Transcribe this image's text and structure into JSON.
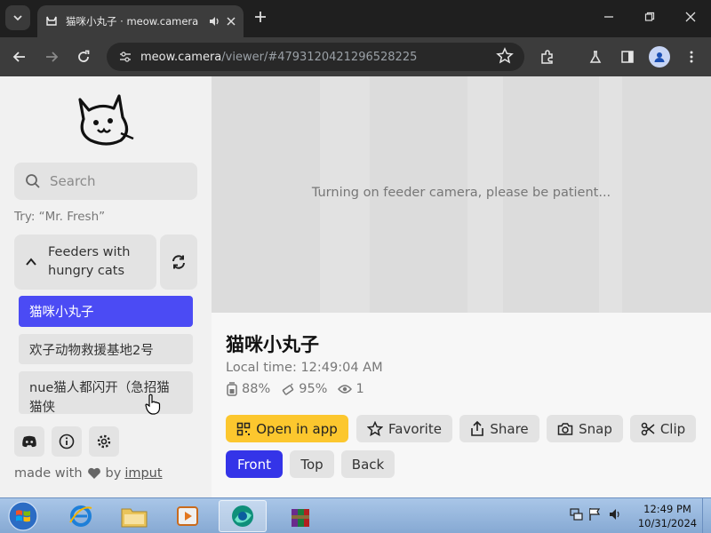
{
  "browser": {
    "tab_title": "猫咪小丸子 · meow.camera",
    "url_host": "meow.camera",
    "url_path": "/viewer/#4793120421296528225"
  },
  "sidebar": {
    "search_placeholder": "Search",
    "search_hint": "Try: “Mr. Fresh”",
    "feeders_label": "Feeders with hungry cats",
    "feeders": [
      {
        "label": "猫咪小丸子",
        "active": true
      },
      {
        "label": "欢子动物救援基地2号",
        "active": false
      },
      {
        "label": "nue猫人都闪开（急招猫猫侠",
        "active": false
      }
    ],
    "footer": {
      "made_with": "made with",
      "by": "by",
      "link": "imput"
    }
  },
  "main": {
    "camera_status": "Turning on feeder camera, please be patient...",
    "feeder_name": "猫咪小丸子",
    "local_time": "Local time: 12:49:04 AM",
    "stats": {
      "food": "88%",
      "battery": "95%",
      "viewers": "1"
    },
    "actions": {
      "open_in_app": "Open in app",
      "favorite": "Favorite",
      "share": "Share",
      "snap": "Snap",
      "clip": "Clip"
    },
    "views": {
      "front": "Front",
      "top": "Top",
      "back": "Back"
    }
  },
  "taskbar": {
    "time": "12:49 PM",
    "date": "10/31/2024"
  },
  "colors": {
    "accent": "#4b4bf4",
    "front_button": "#3434e8",
    "open_app": "#fcc72e"
  }
}
